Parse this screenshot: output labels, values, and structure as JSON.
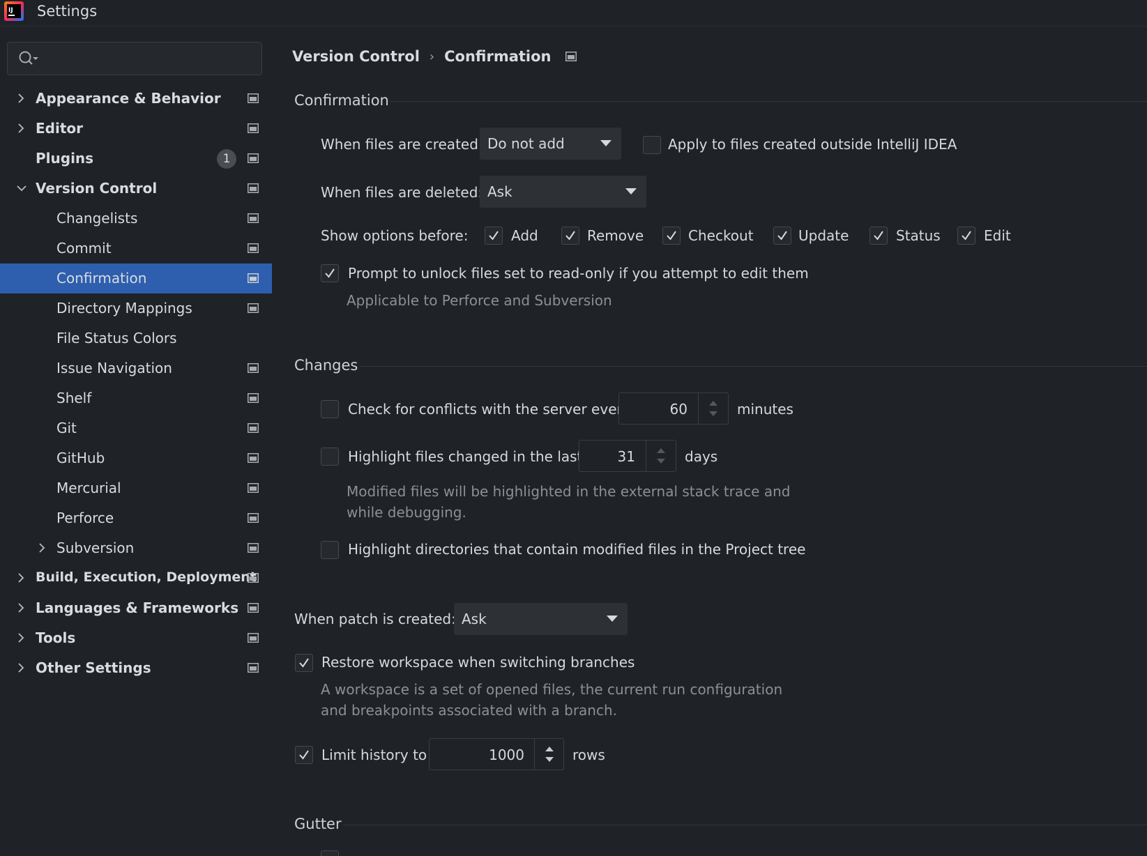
{
  "window": {
    "title": "Settings"
  },
  "search": {
    "placeholder": ""
  },
  "sidebar": {
    "items": [
      {
        "label": "Appearance & Behavior"
      },
      {
        "label": "Editor"
      },
      {
        "label": "Plugins",
        "badge": "1"
      },
      {
        "label": "Version Control"
      },
      {
        "label": "Changelists"
      },
      {
        "label": "Commit"
      },
      {
        "label": "Confirmation"
      },
      {
        "label": "Directory Mappings"
      },
      {
        "label": "File Status Colors"
      },
      {
        "label": "Issue Navigation"
      },
      {
        "label": "Shelf"
      },
      {
        "label": "Git"
      },
      {
        "label": "GitHub"
      },
      {
        "label": "Mercurial"
      },
      {
        "label": "Perforce"
      },
      {
        "label": "Subversion"
      },
      {
        "label": "Build, Execution, Deployment"
      },
      {
        "label": "Languages & Frameworks"
      },
      {
        "label": "Tools"
      },
      {
        "label": "Other Settings"
      }
    ]
  },
  "breadcrumb": {
    "parent": "Version Control",
    "sep": "›",
    "current": "Confirmation"
  },
  "confirmation": {
    "section_title": "Confirmation",
    "files_created_label": "When files are created:",
    "files_created_value": "Do not add",
    "apply_outside_label": "Apply to files created outside IntelliJ IDEA",
    "files_deleted_label": "When files are deleted:",
    "files_deleted_value": "Ask",
    "show_options_label": "Show options before:",
    "options": [
      "Add",
      "Remove",
      "Checkout",
      "Update",
      "Status",
      "Edit"
    ],
    "prompt_unlock_label": "Prompt to unlock files set to read-only if you attempt to edit them",
    "prompt_unlock_hint": "Applicable to Perforce and Subversion"
  },
  "changes": {
    "section_title": "Changes",
    "check_conflicts_label": "Check for conflicts with the server every",
    "check_conflicts_value": "60",
    "check_conflicts_unit": "minutes",
    "highlight_changed_label": "Highlight files changed in the last",
    "highlight_changed_value": "31",
    "highlight_changed_unit": "days",
    "highlight_hint_1": "Modified files will be highlighted in the external stack trace and",
    "highlight_hint_2": "while debugging.",
    "highlight_dirs_label": "Highlight directories that contain modified files in the Project tree"
  },
  "patch": {
    "label": "When patch is created:",
    "value": "Ask"
  },
  "workspace": {
    "restore_label": "Restore workspace when switching branches",
    "hint_1": "A workspace is a set of opened files, the current run configuration",
    "hint_2": "and breakpoints associated with a branch."
  },
  "history": {
    "label": "Limit history to",
    "value": "1000",
    "unit": "rows"
  },
  "gutter": {
    "section_title": "Gutter"
  },
  "colors": {
    "selection": "#2e5faf",
    "background": "#1f2226",
    "control": "#2d3035"
  }
}
